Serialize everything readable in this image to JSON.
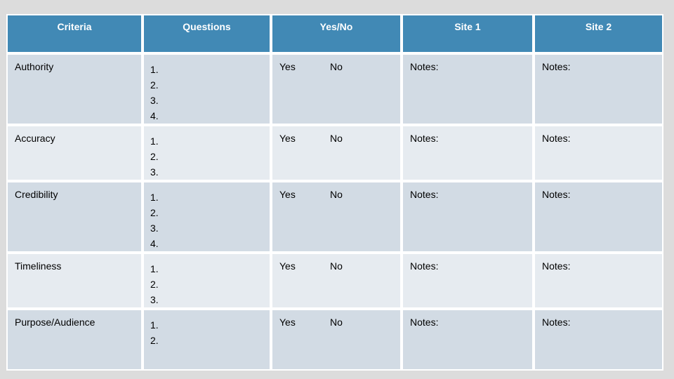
{
  "table": {
    "headers": [
      {
        "label": "Criteria"
      },
      {
        "label": "Questions"
      },
      {
        "label": "Yes/No"
      },
      {
        "label": "Site 1"
      },
      {
        "label": "Site 2"
      }
    ],
    "rows": [
      {
        "criteria": "Authority",
        "questions": [
          "1.",
          "2.",
          "3.",
          "4."
        ],
        "yes": "Yes",
        "no": "No",
        "site1": "Notes:",
        "site2": "Notes:"
      },
      {
        "criteria": "Accuracy",
        "questions": [
          "1.",
          "2.",
          "3."
        ],
        "yes": "Yes",
        "no": "No",
        "site1": "Notes:",
        "site2": "Notes:"
      },
      {
        "criteria": "Credibility",
        "questions": [
          "1.",
          "2.",
          "3.",
          "4."
        ],
        "yes": "Yes",
        "no": "No",
        "site1": "Notes:",
        "site2": "Notes:"
      },
      {
        "criteria": "Timeliness",
        "questions": [
          "1.",
          "2.",
          "3."
        ],
        "yes": "Yes",
        "no": "No",
        "site1": "Notes:",
        "site2": "Notes:"
      },
      {
        "criteria": "Purpose/Audience",
        "questions": [
          "1.",
          "2."
        ],
        "yes": "Yes",
        "no": "No",
        "site1": "Notes:",
        "site2": "Notes:"
      }
    ]
  },
  "colors": {
    "header_background": "#4189b5",
    "header_text": "#ffffff",
    "row_odd_background": "#d2dbe4",
    "row_even_background": "#e6ebf0",
    "grid_line": "#ffffff",
    "page_background": "#dcdcdc",
    "body_text": "#000000"
  }
}
